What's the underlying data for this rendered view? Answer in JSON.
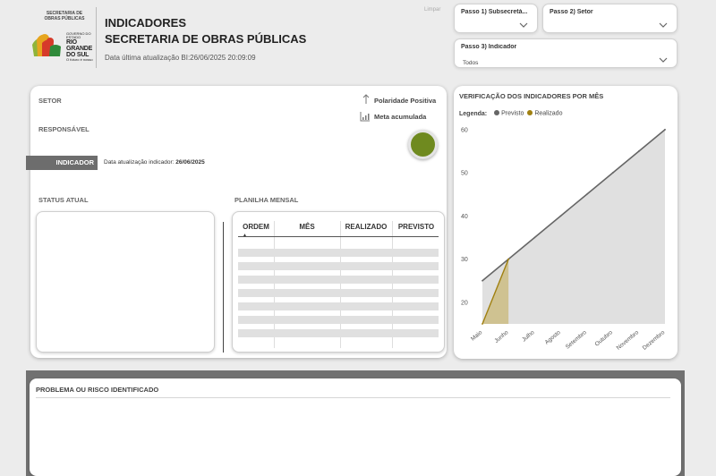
{
  "header": {
    "logo": {
      "secretaria_line1": "SECRETARIA DE",
      "secretaria_line2": "OBRAS PÚBLICAS",
      "gov_small": "GOVERNO DO ESTADO",
      "state_line1": "RIO",
      "state_line2": "GRANDE",
      "state_line3": "DO SUL",
      "tagline": "O futuro é nosso"
    },
    "title_line1": "INDICADORES",
    "title_line2": "SECRETARIA DE OBRAS PÚBLICAS",
    "last_update": "Data última atualização BI:26/06/2025 20:09:09",
    "clear_label": "Limpar"
  },
  "filters": {
    "step1": {
      "label": "Passo 1) Subsecretá...",
      "value": ""
    },
    "step2": {
      "label": "Passo 2) Setor",
      "value": ""
    },
    "step3": {
      "label": "Passo 3) Indicador",
      "value": "Todos"
    }
  },
  "info": {
    "setor_label": "SETOR",
    "responsavel_label": "RESPONSÁVEL",
    "indicador_label": "INDICADOR",
    "indicator_date_label": "Data atualização indicador:",
    "indicator_date_value": "26/06/2025",
    "polarity_label": "Polaridade Positiva",
    "accumulated_label": "Meta acumulada",
    "status_color": "#6f8a1f",
    "status_label": "STATUS ATUAL",
    "monthly_label": "PLANILHA MENSAL"
  },
  "table": {
    "headers": [
      "ORDEM",
      "MÊS",
      "REALIZADO",
      "PREVISTO"
    ],
    "row_count": 7
  },
  "chart": {
    "title": "VERIFICAÇÃO DOS INDICADORES POR MÊS",
    "legend_label": "Legenda:",
    "legend_items": [
      {
        "name": "Previsto",
        "color": "#666666"
      },
      {
        "name": "Realizado",
        "color": "#a08010"
      }
    ]
  },
  "chart_data": {
    "type": "area",
    "title": "VERIFICAÇÃO DOS INDICADORES POR MÊS",
    "categories": [
      "Maio",
      "Junho",
      "Julho",
      "Agosto",
      "Setembro",
      "Outubro",
      "Novembro",
      "Dezembro"
    ],
    "series": [
      {
        "name": "Previsto",
        "values": [
          25,
          30,
          35,
          40,
          45,
          50,
          55,
          60
        ],
        "color": "#666666",
        "fill": "#e0e0e0"
      },
      {
        "name": "Realizado",
        "values": [
          15,
          30,
          null,
          null,
          null,
          null,
          null,
          null
        ],
        "color": "#a08010",
        "fill": "#cdc08c"
      }
    ],
    "yticks": [
      20,
      30,
      40,
      50,
      60
    ],
    "ylim": [
      15,
      61
    ],
    "grid": false,
    "legend": "top-left"
  },
  "problem": {
    "title": "PROBLEMA OU RISCO IDENTIFICADO"
  }
}
